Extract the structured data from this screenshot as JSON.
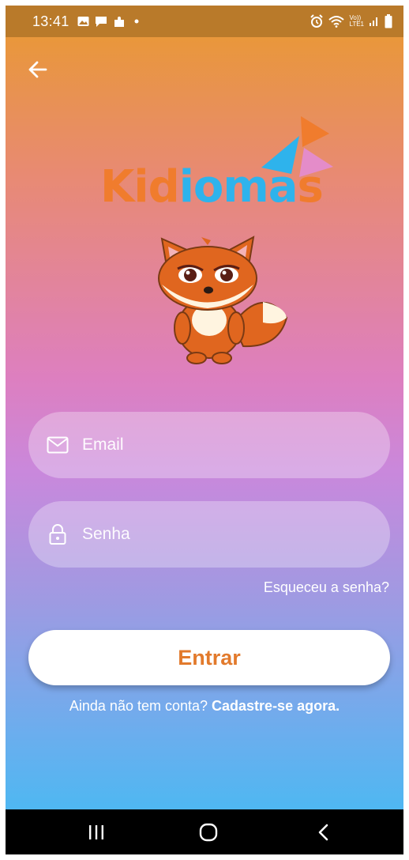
{
  "status_bar": {
    "time": "13:41",
    "left_icons": [
      "image-icon",
      "chat-icon",
      "puzzle-icon",
      "dot-icon"
    ],
    "right_icons": [
      "alarm-icon",
      "wifi-icon",
      "volte-icon",
      "signal-icon",
      "battery-icon"
    ],
    "volte_top": "Vo))",
    "volte_bottom": "LTE1"
  },
  "header": {
    "back_icon": "arrow-left-icon"
  },
  "logo": {
    "part1": "Kid",
    "part2": "ioma",
    "part3": "s"
  },
  "form": {
    "email": {
      "placeholder": "Email",
      "value": "",
      "icon": "mail-icon"
    },
    "password": {
      "placeholder": "Senha",
      "value": "",
      "icon": "lock-icon"
    },
    "forgot_label": "Esqueceu a senha?",
    "submit_label": "Entrar",
    "signup_prompt": "Ainda não tem conta?",
    "signup_link": "Cadastre-se agora."
  },
  "colors": {
    "accent_orange": "#e27a2c",
    "logo_blue": "#2eb3ec",
    "gradient_top": "#e99a2e",
    "gradient_mid": "#dd7fc0",
    "gradient_bottom": "#3ebdf4"
  },
  "nav_bar": {
    "icons": [
      "recent-apps-icon",
      "home-icon",
      "back-icon"
    ]
  }
}
